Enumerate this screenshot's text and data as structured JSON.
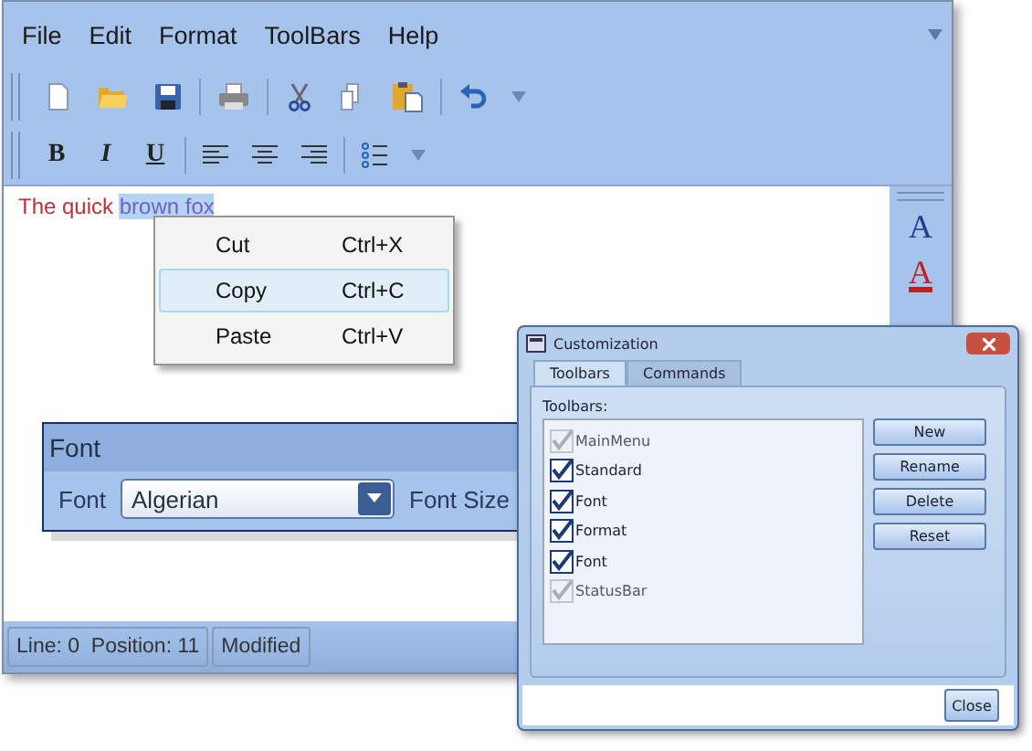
{
  "menu": [
    "File",
    "Edit",
    "Format",
    "ToolBars",
    "Help"
  ],
  "format_toolbar": {
    "style_buttons": [
      "B",
      "I",
      "U"
    ]
  },
  "editor": {
    "text_before": "The quick ",
    "selected_text": "brown fox"
  },
  "context_menu": [
    {
      "label": "Cut",
      "shortcut": "Ctrl+X",
      "selected": false
    },
    {
      "label": "Copy",
      "shortcut": "Ctrl+C",
      "selected": true
    },
    {
      "label": "Paste",
      "shortcut": "Ctrl+V",
      "selected": false
    }
  ],
  "side_toolbar": [
    "A",
    "A"
  ],
  "font_panel": {
    "title": "Font",
    "font_label": "Font",
    "font_value": "Algerian",
    "size_label": "Font Size"
  },
  "status_bar": [
    "Line: 0  Position: 11",
    "Modified"
  ],
  "dialog": {
    "title": "Customization",
    "tabs": [
      {
        "label": "Toolbars",
        "selected": true
      },
      {
        "label": "Commands",
        "selected": false
      }
    ],
    "list_label": "Toolbars:",
    "toolbars": [
      {
        "label": "MainMenu",
        "checked": true,
        "disabled": true
      },
      {
        "label": "Standard",
        "checked": true,
        "disabled": false
      },
      {
        "label": "Font",
        "checked": true,
        "disabled": false
      },
      {
        "label": "Format",
        "checked": true,
        "disabled": false
      },
      {
        "label": "Font",
        "checked": true,
        "disabled": false
      },
      {
        "label": "StatusBar",
        "checked": true,
        "disabled": true
      }
    ],
    "buttons": [
      "New",
      "Rename",
      "Delete",
      "Reset"
    ],
    "close": "Close"
  }
}
